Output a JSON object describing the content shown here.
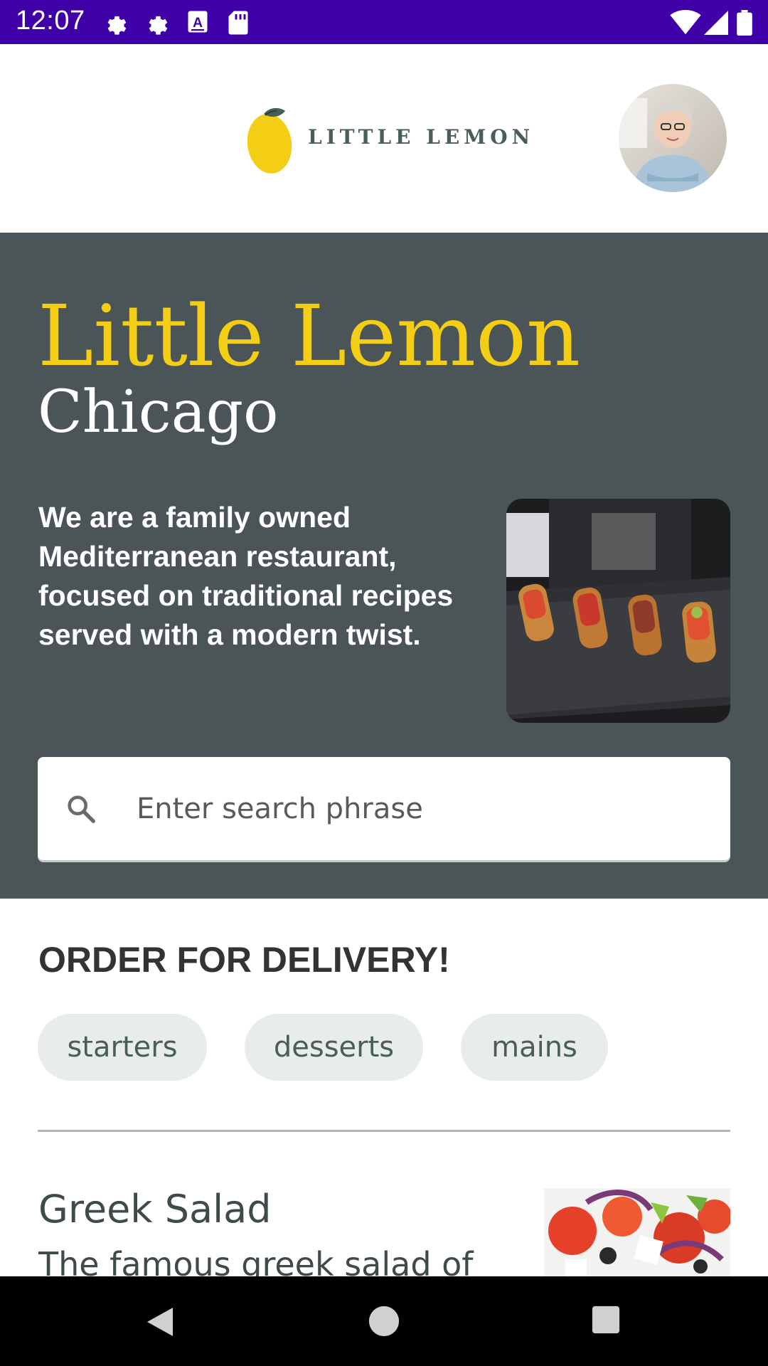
{
  "status_bar": {
    "time": "12:07",
    "left_icons": [
      "gear-icon",
      "gear-icon",
      "keyboard-a-icon",
      "sd-card-icon"
    ],
    "right_icons": [
      "wifi-icon",
      "signal-icon",
      "battery-icon"
    ],
    "color": "#3f00a8"
  },
  "header": {
    "logo_text": "LITTLE LEMON",
    "logo_icon": "lemon-icon",
    "avatar": "profile-avatar"
  },
  "hero": {
    "title": "Little Lemon",
    "city": "Chicago",
    "description": "We are a family owned Mediterranean restaurant, focused on traditional recipes served with a modern twist.",
    "background": "#4b5558",
    "title_color": "#f4ce14"
  },
  "search": {
    "placeholder": "Enter search phrase",
    "icon": "search-icon"
  },
  "delivery": {
    "heading": "ORDER FOR DELIVERY!",
    "categories": [
      "starters",
      "desserts",
      "mains"
    ]
  },
  "menu": {
    "items": [
      {
        "name": "Greek Salad",
        "description": "The famous greek salad of"
      }
    ]
  },
  "nav_bar": {
    "buttons": [
      "back-icon",
      "home-icon",
      "recents-icon"
    ]
  }
}
